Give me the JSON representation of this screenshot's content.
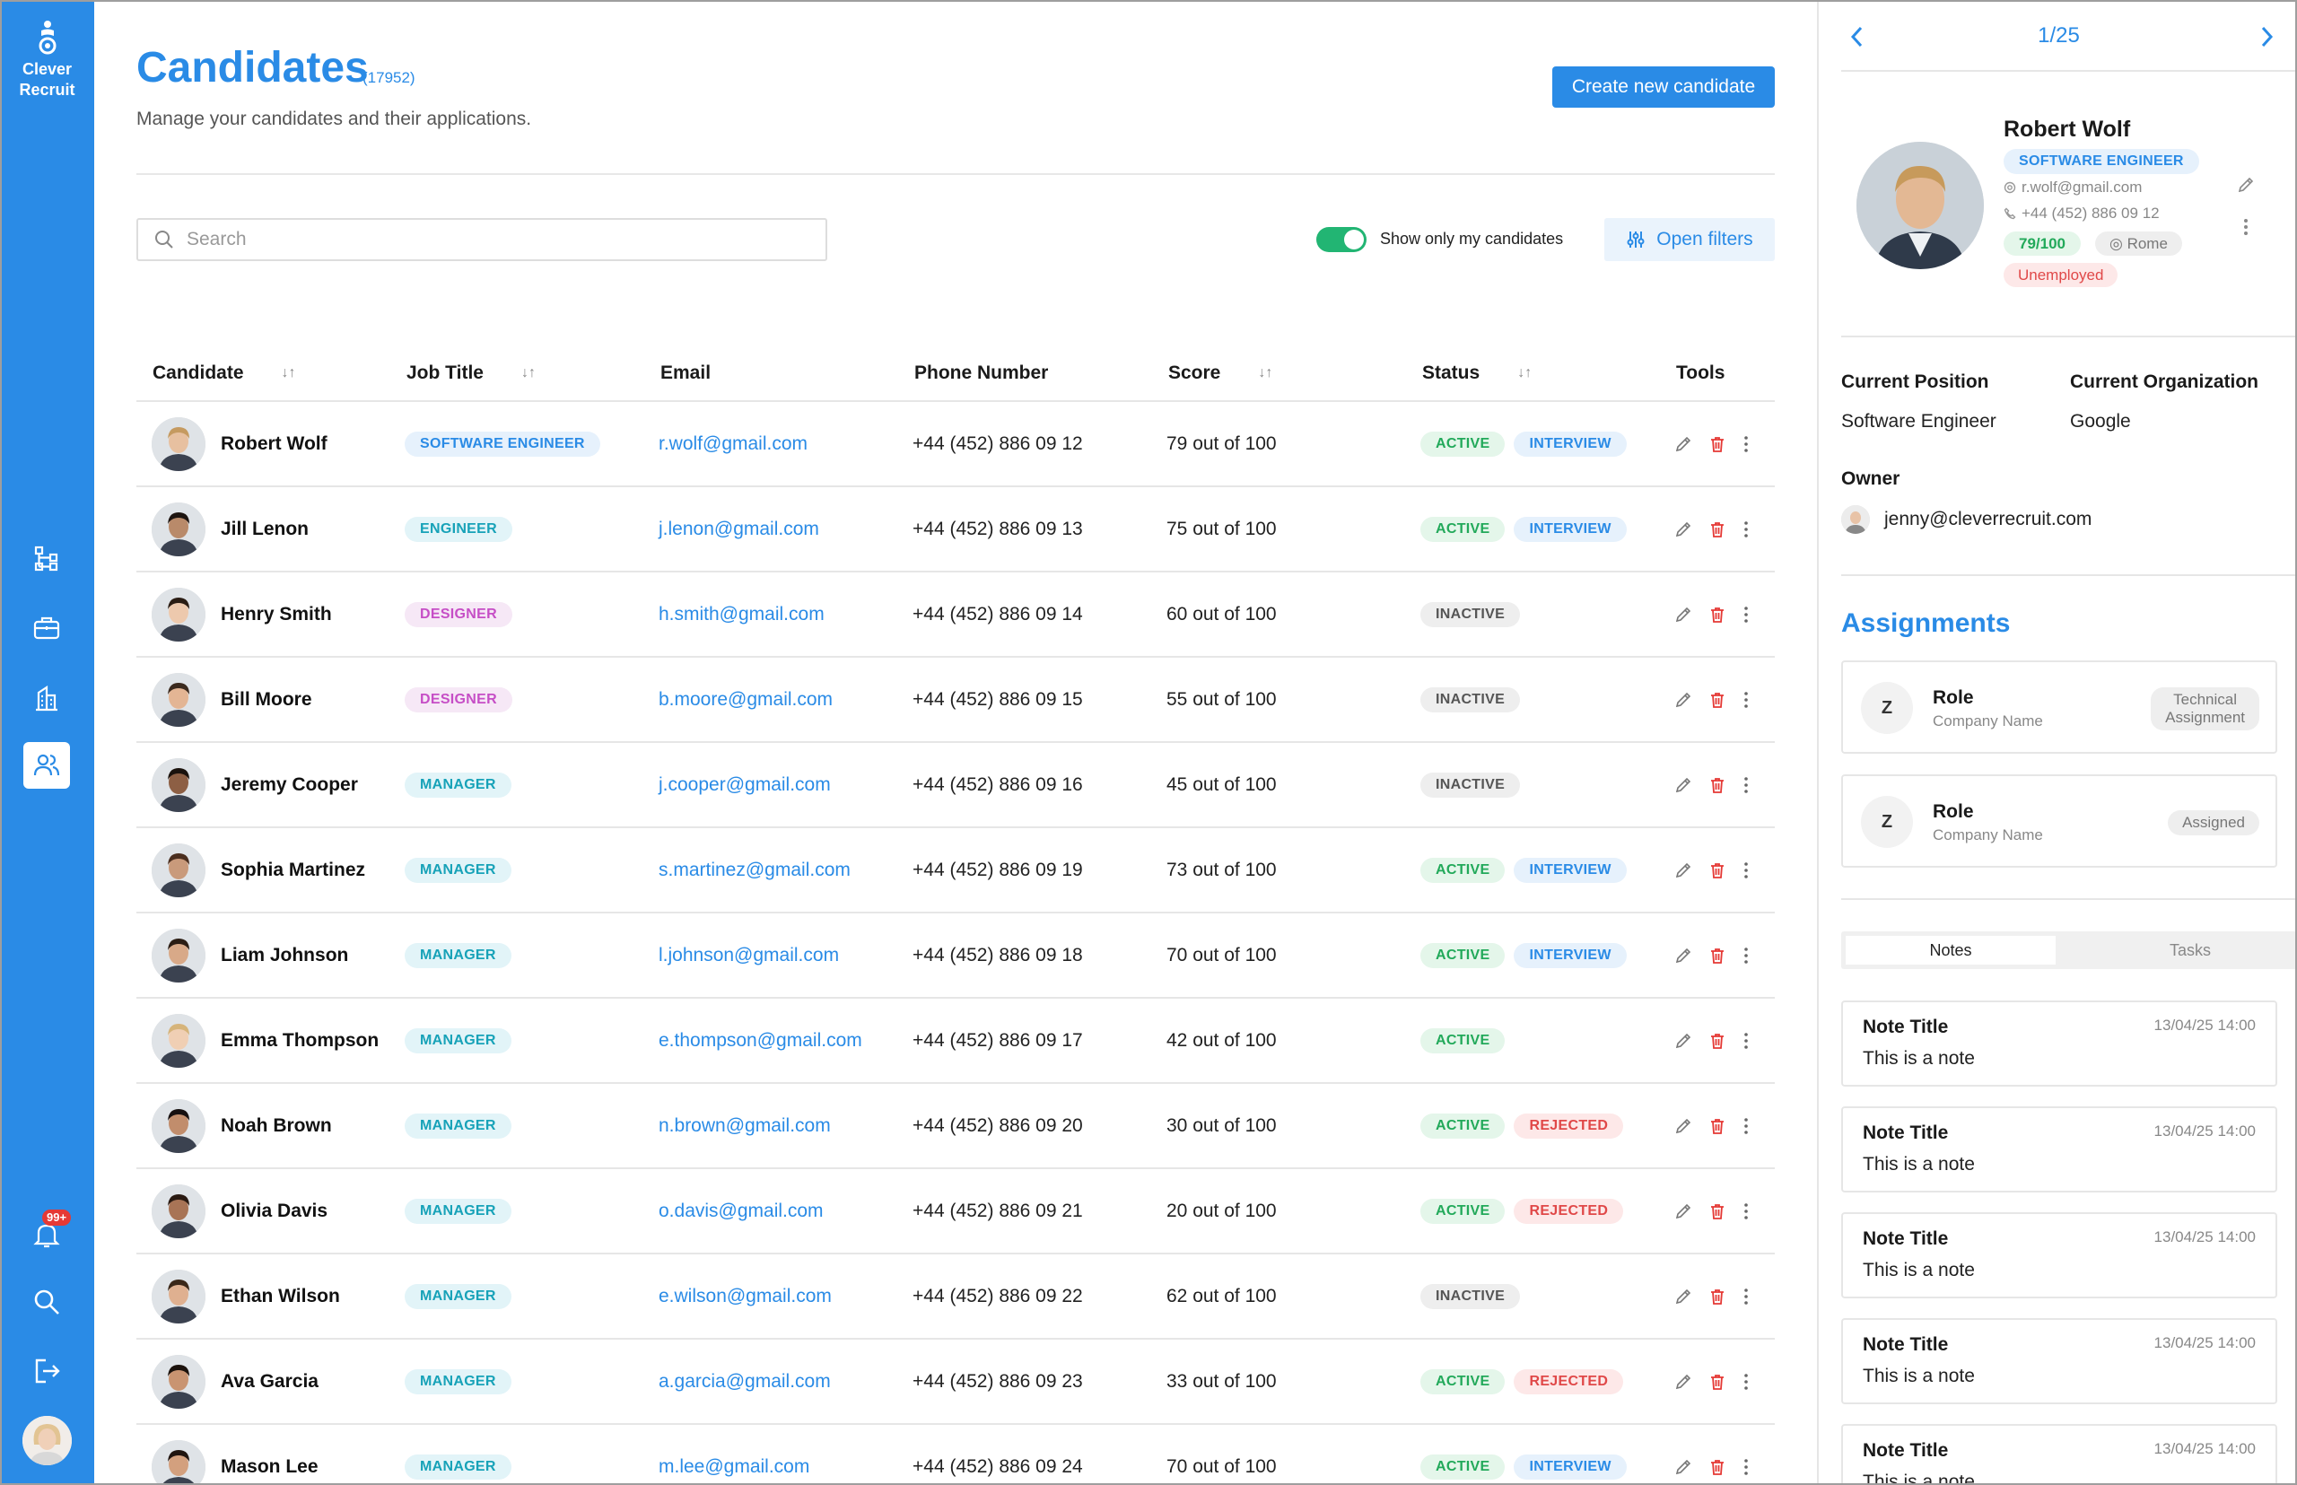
{
  "app": {
    "brand_line1": "Clever",
    "brand_line2": "Recruit",
    "notif_badge": "99+"
  },
  "header": {
    "title": "Candidates",
    "count": "(17952)",
    "subtitle": "Manage your candidates and their applications.",
    "create_button": "Create new candidate"
  },
  "toolbar": {
    "search_placeholder": "Search",
    "toggle_label": "Show only my candidates",
    "toggle_on": true,
    "filters_button": "Open filters"
  },
  "table": {
    "columns": [
      "Candidate",
      "Job Title",
      "Email",
      "Phone Number",
      "Score",
      "Status",
      "Tools"
    ],
    "rows": [
      {
        "name": "Robert Wolf",
        "job": "SOFTWARE ENGINEER",
        "jobtype": "se",
        "email": "r.wolf@gmail.com",
        "phone": "+44 (452) 886 09 12",
        "score": "79 out of 100",
        "status": [
          "ACTIVE",
          "INTERVIEW"
        ]
      },
      {
        "name": "Jill Lenon",
        "job": "ENGINEER",
        "jobtype": "eng",
        "email": "j.lenon@gmail.com",
        "phone": "+44 (452) 886 09 13",
        "score": "75 out of 100",
        "status": [
          "ACTIVE",
          "INTERVIEW"
        ]
      },
      {
        "name": "Henry Smith",
        "job": "DESIGNER",
        "jobtype": "des",
        "email": "h.smith@gmail.com",
        "phone": "+44 (452) 886 09 14",
        "score": "60 out of 100",
        "status": [
          "INACTIVE"
        ]
      },
      {
        "name": "Bill Moore",
        "job": "DESIGNER",
        "jobtype": "des",
        "email": "b.moore@gmail.com",
        "phone": "+44 (452) 886 09 15",
        "score": "55 out of 100",
        "status": [
          "INACTIVE"
        ]
      },
      {
        "name": "Jeremy Cooper",
        "job": "MANAGER",
        "jobtype": "mgr",
        "email": "j.cooper@gmail.com",
        "phone": "+44 (452) 886 09 16",
        "score": "45 out of 100",
        "status": [
          "INACTIVE"
        ]
      },
      {
        "name": "Sophia Martinez",
        "job": "MANAGER",
        "jobtype": "mgr",
        "email": "s.martinez@gmail.com",
        "phone": "+44 (452) 886 09 19",
        "score": "73 out of 100",
        "status": [
          "ACTIVE",
          "INTERVIEW"
        ]
      },
      {
        "name": "Liam Johnson",
        "job": "MANAGER",
        "jobtype": "mgr",
        "email": "l.johnson@gmail.com",
        "phone": "+44 (452) 886 09 18",
        "score": "70 out of 100",
        "status": [
          "ACTIVE",
          "INTERVIEW"
        ]
      },
      {
        "name": "Emma Thompson",
        "job": "MANAGER",
        "jobtype": "mgr",
        "email": "e.thompson@gmail.com",
        "phone": "+44 (452) 886 09 17",
        "score": "42 out of 100",
        "status": [
          "ACTIVE"
        ]
      },
      {
        "name": "Noah Brown",
        "job": "MANAGER",
        "jobtype": "mgr",
        "email": "n.brown@gmail.com",
        "phone": "+44 (452) 886 09 20",
        "score": "30 out of 100",
        "status": [
          "ACTIVE",
          "REJECTED"
        ]
      },
      {
        "name": "Olivia Davis",
        "job": "MANAGER",
        "jobtype": "mgr",
        "email": "o.davis@gmail.com",
        "phone": "+44 (452) 886 09 21",
        "score": "20 out of 100",
        "status": [
          "ACTIVE",
          "REJECTED"
        ]
      },
      {
        "name": "Ethan Wilson",
        "job": "MANAGER",
        "jobtype": "mgr",
        "email": "e.wilson@gmail.com",
        "phone": "+44 (452) 886 09 22",
        "score": "62 out of 100",
        "status": [
          "INACTIVE"
        ]
      },
      {
        "name": "Ava Garcia",
        "job": "MANAGER",
        "jobtype": "mgr",
        "email": "a.garcia@gmail.com",
        "phone": "+44 (452) 886 09 23",
        "score": "33 out of 100",
        "status": [
          "ACTIVE",
          "REJECTED"
        ]
      },
      {
        "name": "Mason Lee",
        "job": "MANAGER",
        "jobtype": "mgr",
        "email": "m.lee@gmail.com",
        "phone": "+44 (452) 886 09 24",
        "score": "70 out of 100",
        "status": [
          "ACTIVE",
          "INTERVIEW"
        ]
      }
    ]
  },
  "panel": {
    "pager": "1/25",
    "name": "Robert Wolf",
    "role": "SOFTWARE ENGINEER",
    "email": "r.wolf@gmail.com",
    "phone": "+44 (452) 886 09 12",
    "score": "79/100",
    "location": "Rome",
    "employment": "Unemployed",
    "current_position_label": "Current Position",
    "current_position": "Software Engineer",
    "current_org_label": "Current Organization",
    "current_org": "Google",
    "owner_label": "Owner",
    "owner": "jenny@cleverrecruit.com",
    "assignments_title": "Assignments",
    "assignments": [
      {
        "role": "Role",
        "company": "Company Name",
        "status_line1": "Technical",
        "status_line2": "Assignment"
      },
      {
        "role": "Role",
        "company": "Company Name",
        "status_line1": "Assigned",
        "status_line2": ""
      }
    ],
    "tabs": [
      "Notes",
      "Tasks"
    ],
    "notes": [
      {
        "title": "Note Title",
        "date": "13/04/25 14:00",
        "text": "This is a note"
      },
      {
        "title": "Note Title",
        "date": "13/04/25 14:00",
        "text": "This is a note"
      },
      {
        "title": "Note Title",
        "date": "13/04/25 14:00",
        "text": "This is a note"
      },
      {
        "title": "Note Title",
        "date": "13/04/25 14:00",
        "text": "This is a note"
      },
      {
        "title": "Note Title",
        "date": "13/04/25 14:00",
        "text": "This is a note"
      }
    ]
  }
}
